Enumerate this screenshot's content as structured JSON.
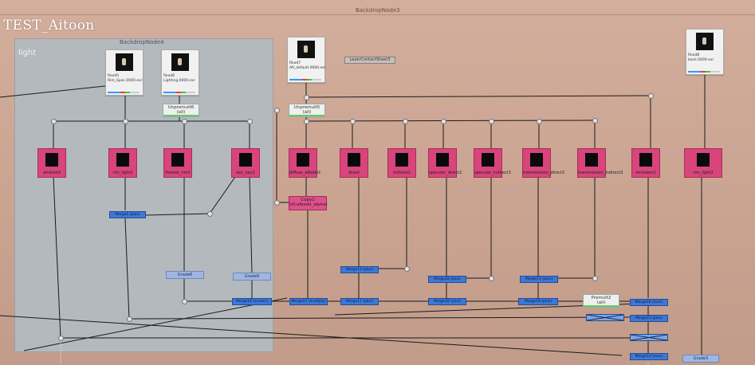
{
  "watermark": "TEST_Aitoon",
  "backdrops": {
    "outer_title": "BackdropNode3",
    "inner_title": "BackdropNode4",
    "inner_label": "light"
  },
  "read_nodes": [
    {
      "id": "read-a",
      "name": "Read5",
      "file": "Rim_Spec.0000.exr"
    },
    {
      "id": "read-b",
      "name": "Read6",
      "file": "Lighting.0000.exr"
    },
    {
      "id": "read-c",
      "name": "Read7",
      "file": "Alt_default.0000.exr"
    },
    {
      "id": "read-d",
      "name": "Read8",
      "file": "back.0000.exr"
    }
  ],
  "contact_sheet": "LayerContactSheet3",
  "unpremult_nodes": [
    {
      "label": "Unpremult6",
      "sub": "(all)"
    },
    {
      "label": "Unpremult5",
      "sub": "(all)"
    }
  ],
  "copy_node": {
    "label": "Copy1",
    "sub": "(dl:albedo_alpha)"
  },
  "premult_node": {
    "label": "Premult2",
    "sub": "(all)"
  },
  "shuffle_nodes": [
    "ambieo3",
    "rim_light2",
    "fresnel_rim3",
    "key_key3",
    "diffuse_albedo1",
    "direct",
    "indirect1",
    "specular_direct2",
    "specular_indirect3",
    "transmission_direct3",
    "transmission_indirect3",
    "emission2",
    "rim_light3"
  ],
  "blue_nodes": [
    "Merge1 (plus)",
    "Merge13 (plus)",
    "Merge10 (plus)",
    "Merge11 (plus)",
    "Merge16 (screen)",
    "Merge15 (multiply)",
    "Merge17 (plus)",
    "Merge18 (plus)",
    "Merge19 (plus)",
    "Merge20 (over)",
    "Merge21 (plus)",
    "Merge22 (over)",
    "Merge14 (over)"
  ],
  "grade_nodes": [
    "Grade8",
    "Grade9",
    "Grade3"
  ]
}
